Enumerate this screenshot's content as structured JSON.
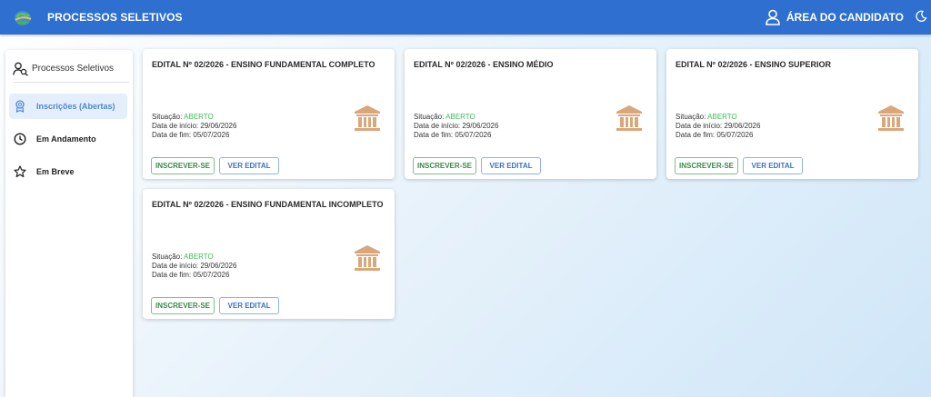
{
  "header": {
    "title": "PROCESSOS SELETIVOS",
    "user_area_label": "ÁREA DO CANDIDATO",
    "logo_icon": "globe-logo-icon",
    "theme_icon": "moon-icon",
    "color": "#2e6fcf"
  },
  "sidebar": {
    "header_label": "Processos Seletivos",
    "items": [
      {
        "label": "Inscrições (Abertas)",
        "icon": "award-icon",
        "active": true
      },
      {
        "label": "Em Andamento",
        "icon": "clock-icon",
        "active": false
      },
      {
        "label": "Em Breve",
        "icon": "star-icon",
        "active": false
      }
    ]
  },
  "cards": [
    {
      "title": "EDITAL Nº 02/2026 - ENSINO FUNDAMENTAL COMPLETO",
      "status_label": "Situação:",
      "status_value": "ABERTO",
      "start_label": "Data de início:",
      "start_date": "29/06/2026",
      "end_label": "Data de fim:",
      "end_date": "05/07/2026",
      "btn_subscribe": "INSCREVER-SE",
      "btn_view": "VER EDITAL"
    },
    {
      "title": "EDITAL Nº 02/2026 - ENSINO MÉDIO",
      "status_label": "Situação:",
      "status_value": "ABERTO",
      "start_label": "Data de início:",
      "start_date": "29/06/2026",
      "end_label": "Data de fim:",
      "end_date": "05/07/2026",
      "btn_subscribe": "INSCREVER-SE",
      "btn_view": "VER EDITAL"
    },
    {
      "title": "EDITAL Nº 02/2026 - ENSINO SUPERIOR",
      "status_label": "Situação:",
      "status_value": "ABERTO",
      "start_label": "Data de início:",
      "start_date": "29/06/2026",
      "end_label": "Data de fim:",
      "end_date": "05/07/2026",
      "btn_subscribe": "INSCREVER-SE",
      "btn_view": "VER EDITAL"
    },
    {
      "title": "EDITAL Nº 02/2026 - ENSINO FUNDAMENTAL INCOMPLETO",
      "status_label": "Situação:",
      "status_value": "ABERTO",
      "start_label": "Data de início:",
      "start_date": "29/06/2026",
      "end_label": "Data de fim:",
      "end_date": "05/07/2026",
      "btn_subscribe": "INSCREVER-SE",
      "btn_view": "VER EDITAL"
    }
  ],
  "colors": {
    "status_open": "#3dbb5b",
    "bank_icon": "#d9a77a",
    "active_item": "#4a86d6"
  }
}
